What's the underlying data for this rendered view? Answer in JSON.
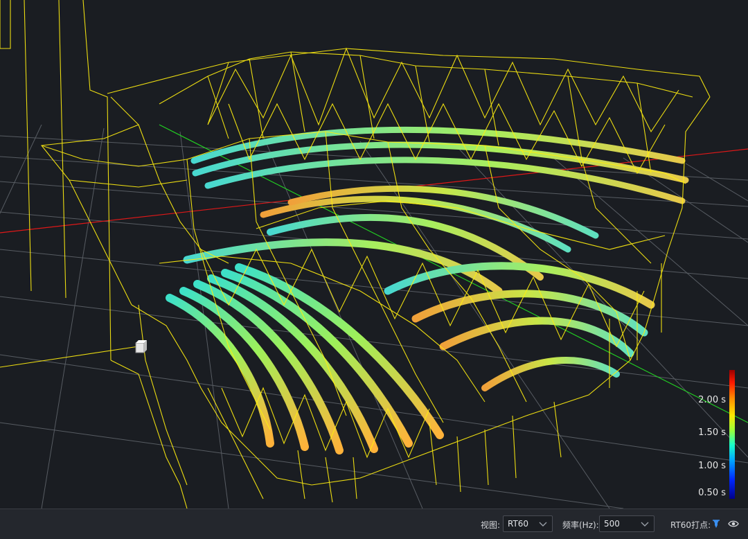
{
  "legend": {
    "ticks": [
      "2.00 s",
      "1.50 s",
      "1.00 s",
      "0.50 s"
    ]
  },
  "toolbar": {
    "view_label": "视图:",
    "view_value": "RT60",
    "freq_label": "频率(Hz):",
    "freq_value": "500",
    "rt60_points_label": "RT60打点:"
  },
  "icons": {
    "points": "pin-icon",
    "visibility": "eye-icon"
  },
  "colors": {
    "wireframe": "#ffee10",
    "axis_x": "#e01818",
    "axis_y": "#22d022",
    "grid": "#9aa0a8",
    "background": "#1a1d22",
    "toolbar_bg": "#24272d",
    "accent_icon": "#3a8ff0"
  }
}
